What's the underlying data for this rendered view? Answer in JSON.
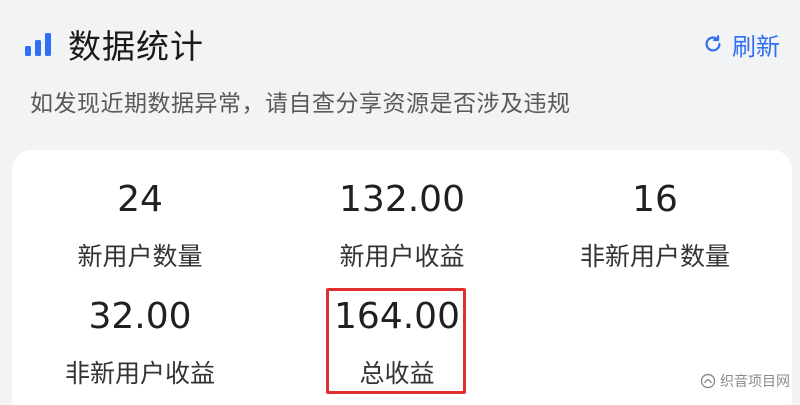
{
  "header": {
    "title": "数据统计",
    "title_icon": "bar-chart-icon",
    "refresh_label": "刷新",
    "refresh_icon": "refresh-icon",
    "accent_color": "#2f6ff5"
  },
  "notice": "如发现近期数据异常，请自查分享资源是否涉及违规",
  "stats": [
    {
      "value": "24",
      "label": "新用户数量"
    },
    {
      "value": "132.00",
      "label": "新用户收益"
    },
    {
      "value": "16",
      "label": "非新用户数量"
    },
    {
      "value": "32.00",
      "label": "非新用户收益"
    },
    {
      "value": "164.00",
      "label": "总收益",
      "highlighted": true
    }
  ],
  "highlight_color": "#e03131",
  "watermark": {
    "text": "织音项目网",
    "icon": "watermark-logo-icon"
  }
}
